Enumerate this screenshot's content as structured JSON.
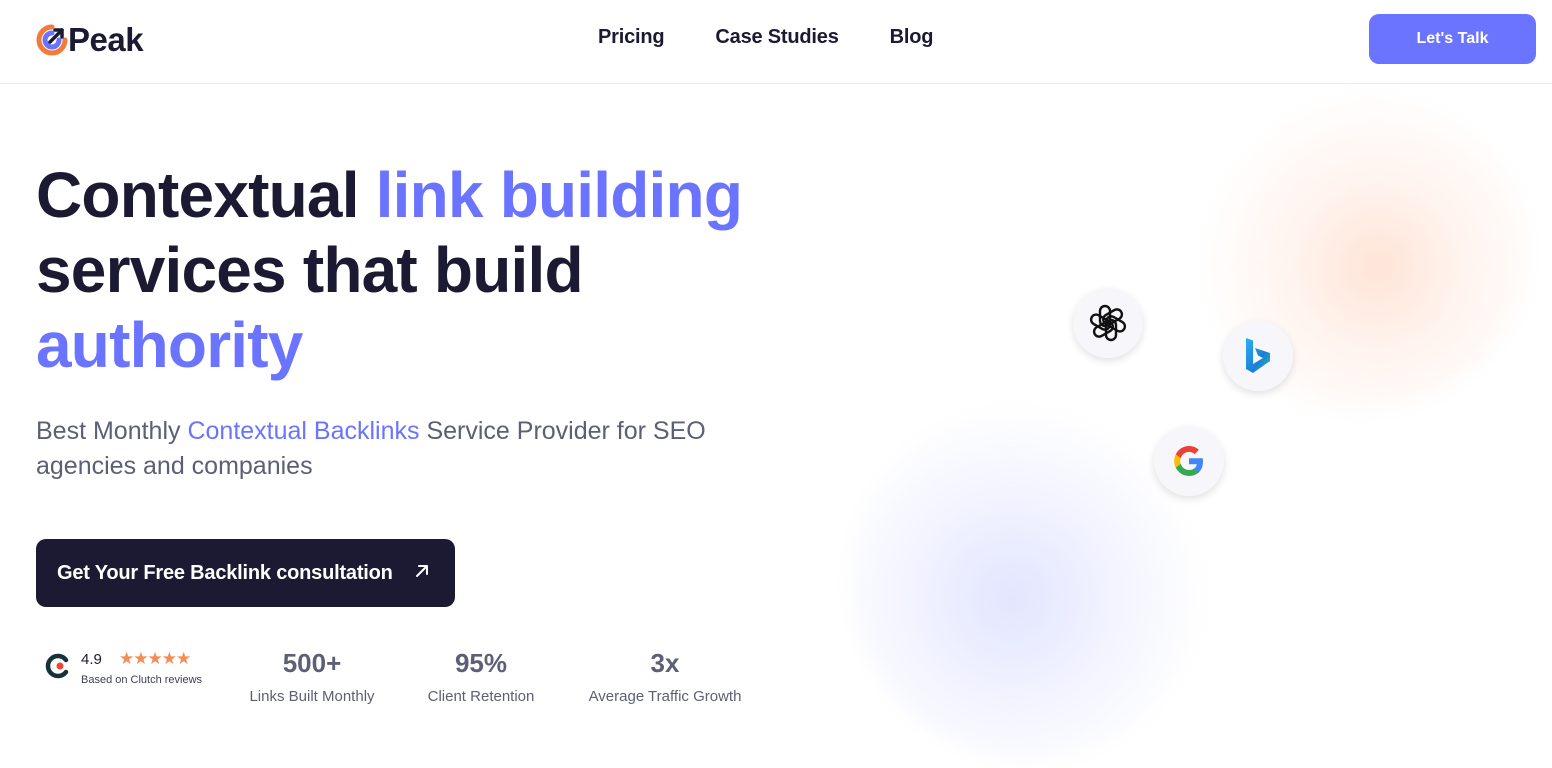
{
  "brand": {
    "name": "Peak"
  },
  "nav": {
    "items": [
      "Pricing",
      "Case Studies",
      "Blog"
    ]
  },
  "header": {
    "cta_label": "Let's Talk"
  },
  "hero": {
    "headline_part1": "Contextual ",
    "headline_accent1": "link building",
    "headline_part2": "services that build",
    "headline_accent2": "authority",
    "sub_part1": "Best Monthly ",
    "sub_accent": "Contextual Backlinks",
    "sub_part2": " Service Provider for SEO agencies and companies",
    "cta_label": "Get Your Free Backlink consultation"
  },
  "rating": {
    "value": "4.9",
    "stars": "★★★★★",
    "caption": "Based on Clutch reviews"
  },
  "stats": [
    {
      "value": "500+",
      "label": "Links Built Monthly"
    },
    {
      "value": "95%",
      "label": "Client Retention"
    },
    {
      "value": "3x",
      "label": "Average Traffic Growth"
    }
  ],
  "colors": {
    "accent": "#6b74ff",
    "dark": "#1c1a32",
    "muted": "#5c5f75",
    "star": "#f58c55"
  },
  "icons": [
    "openai-icon",
    "bing-icon",
    "google-icon",
    "clutch-icon",
    "arrow-up-right-icon"
  ]
}
